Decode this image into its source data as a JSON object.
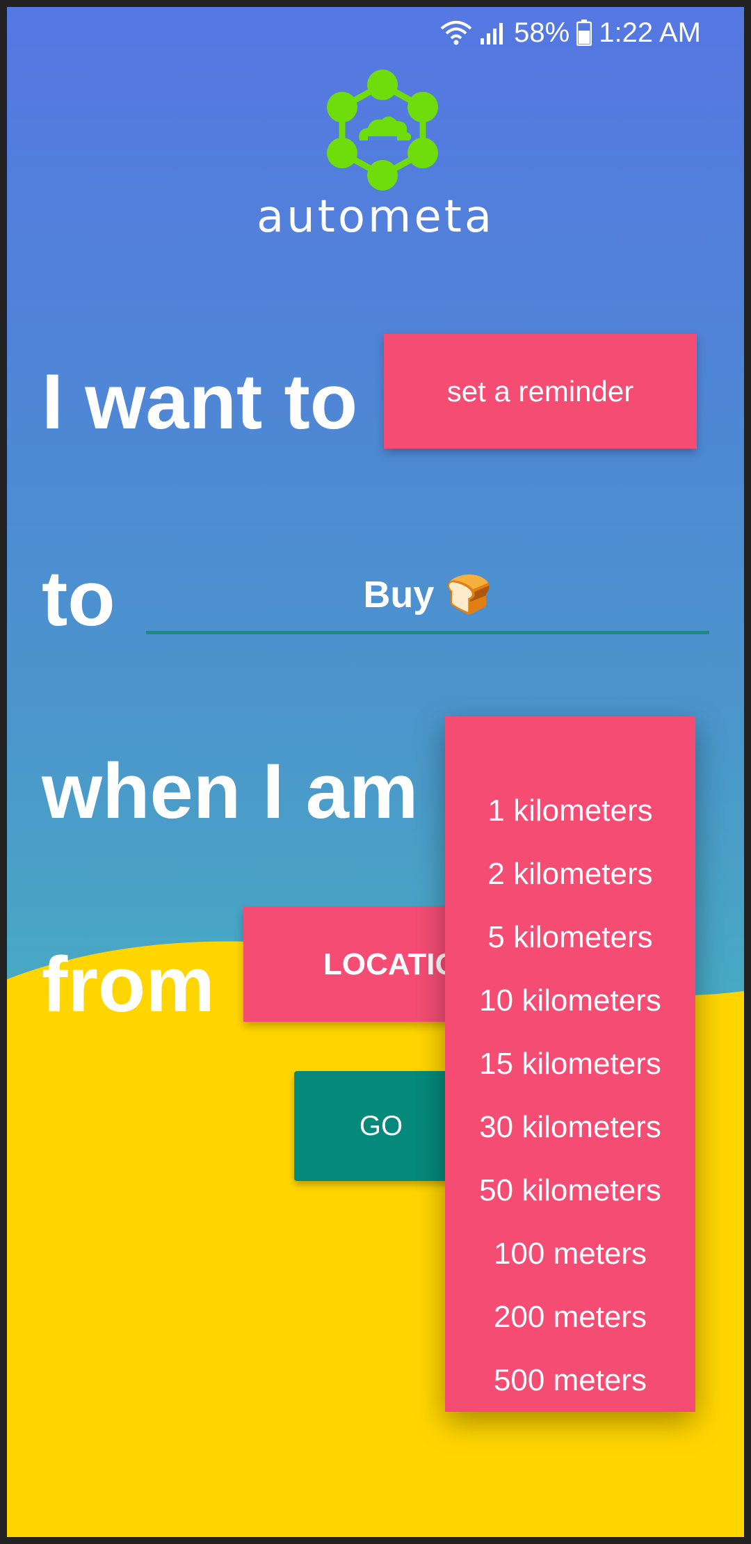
{
  "status_bar": {
    "battery": "58%",
    "time": "1:22 AM",
    "icons": [
      "wifi-icon",
      "signal-icon",
      "battery-icon"
    ]
  },
  "app": {
    "name": "autometa",
    "logo_icon": "hexagon-cloud-logo"
  },
  "form": {
    "line1_label": "I want to",
    "action_value": "set a reminder",
    "line2_label": "to",
    "task_value": "Buy",
    "task_emoji": "🍞",
    "line3_label": "when I am",
    "line4_label": "from",
    "location_button": "LOCATIO",
    "go_button": "GO"
  },
  "distance_dropdown": {
    "options": [
      "1 kilometers",
      "2 kilometers",
      "5 kilometers",
      "10 kilometers",
      "15 kilometers",
      "30 kilometers",
      "50 kilometers",
      "100 meters",
      "200 meters",
      "500 meters"
    ]
  },
  "colors": {
    "accent_pink": "#f44c73",
    "go_teal": "#05897a",
    "wave_yellow": "#ffd500",
    "logo_green": "#6fdc0b"
  }
}
